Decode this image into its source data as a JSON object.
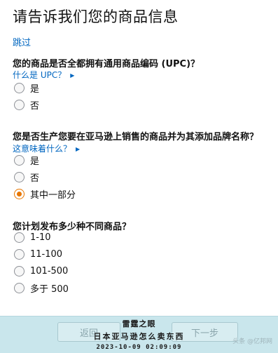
{
  "page": {
    "title": "请告诉我们您的商品信息",
    "skip_label": "跳过"
  },
  "q1": {
    "question": "您的商品是否全都拥有通用商品编码 (UPC)？",
    "help": "什么是 UPC？",
    "options": [
      "是",
      "否"
    ],
    "selected": null
  },
  "q2": {
    "question": "您是否生产您要在亚马逊上销售的商品并为其添加品牌名称？",
    "help": "这意味着什么？",
    "options": [
      "是",
      "否",
      "其中一部分"
    ],
    "selected": "其中一部分"
  },
  "q3": {
    "question": "您计划发布多少种不同商品？",
    "options": [
      "1-10",
      "11-100",
      "101-500",
      "多于 500"
    ],
    "selected": null
  },
  "footer": {
    "back_label": "返回",
    "next_label": "下一步",
    "stamp_title": "雷霆之眼",
    "stamp_subtitle": "日本亚马逊怎么卖东西",
    "stamp_date": "2023-10-09 02:09:09",
    "watermark": "头条 @亿邦网"
  },
  "colors": {
    "link": "#0066c0",
    "radio_selected": "#e77600",
    "footer_bg": "#c9e6ec"
  }
}
